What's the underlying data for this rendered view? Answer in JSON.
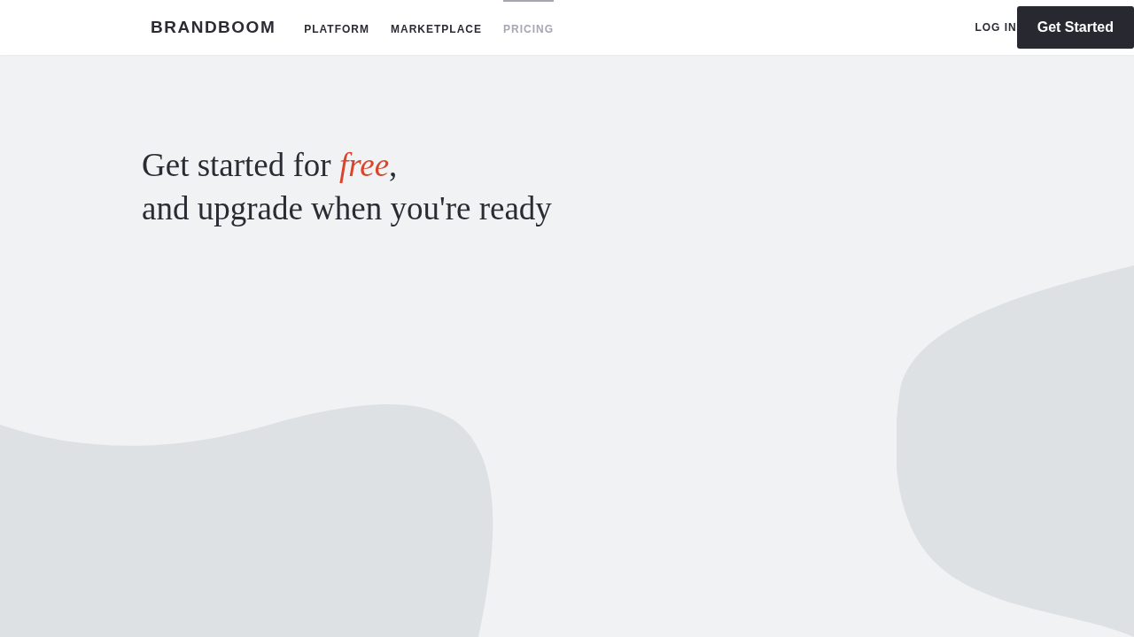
{
  "header": {
    "logo": "BRANDBOOM",
    "nav": [
      {
        "label": "PLATFORM",
        "selected": false
      },
      {
        "label": "MARKETPLACE",
        "selected": false
      },
      {
        "label": "PRICING",
        "selected": true
      }
    ],
    "login": "LOG IN",
    "cta": "Get Started"
  },
  "hero": {
    "headline": "Get started for *free*,\nand upgrade when you're ready"
  }
}
